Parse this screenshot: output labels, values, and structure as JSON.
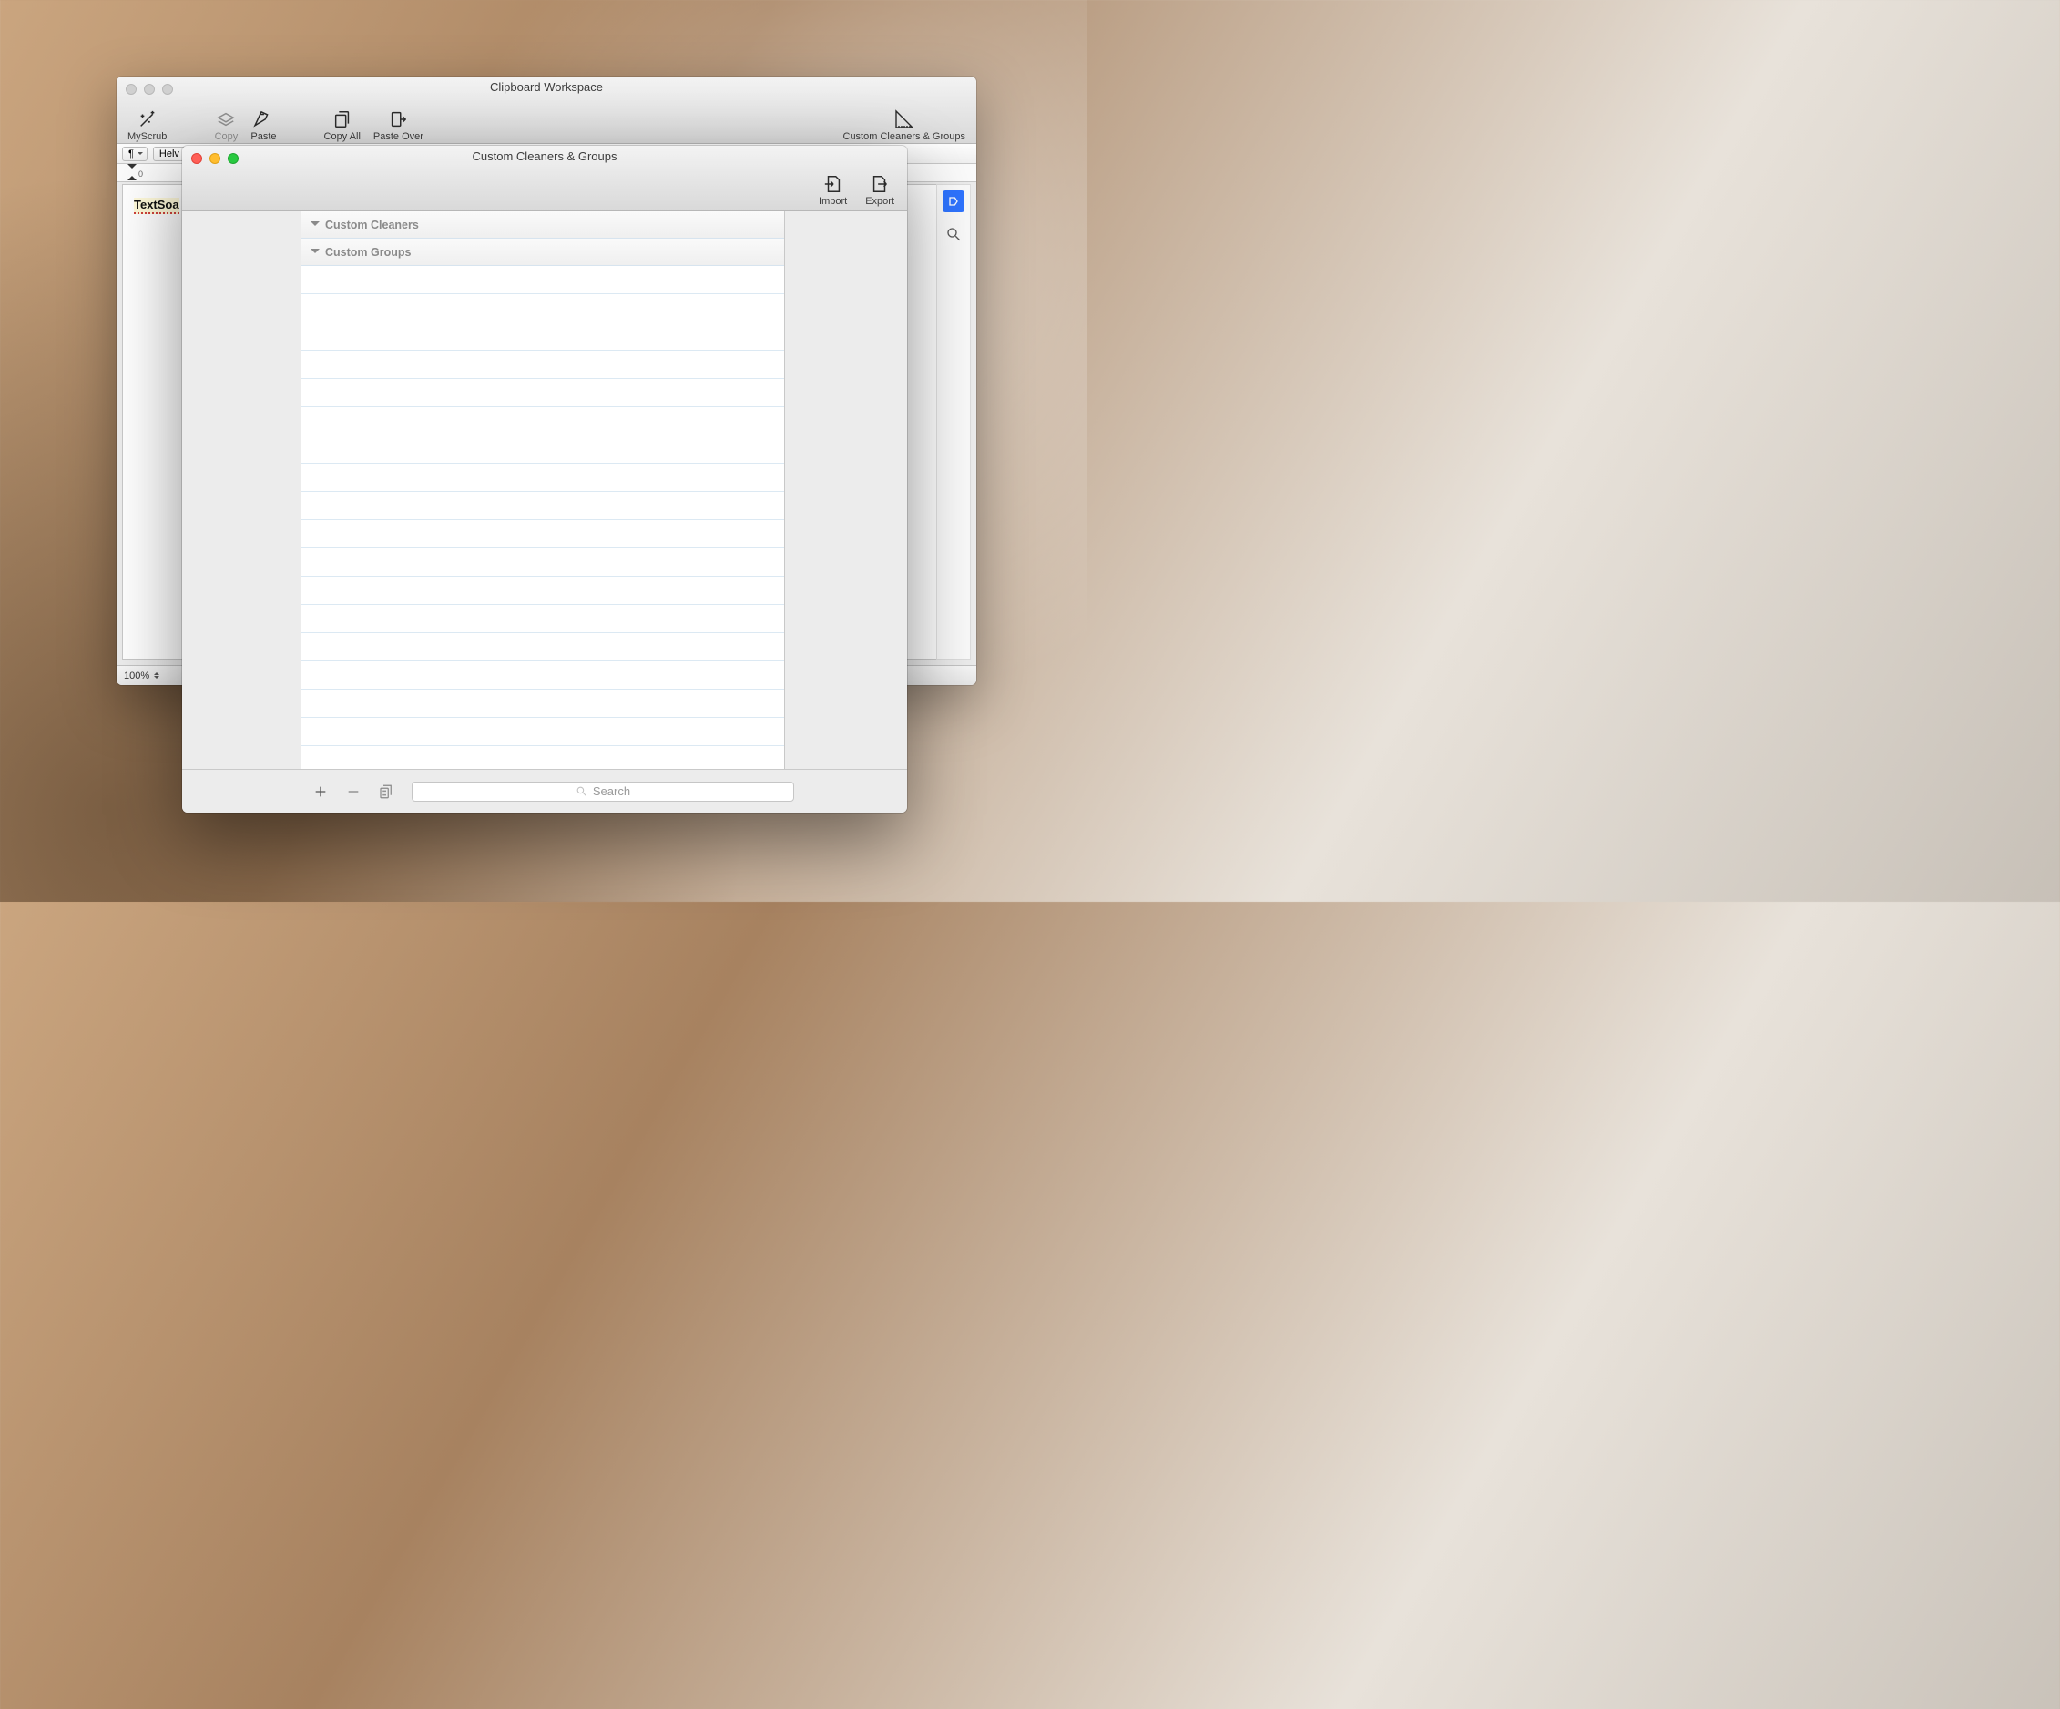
{
  "back": {
    "title": "Clipboard Workspace",
    "toolbar": {
      "myscrub": "MyScrub",
      "copy": "Copy",
      "paste": "Paste",
      "copy_all": "Copy All",
      "paste_over": "Paste Over",
      "custom": "Custom Cleaners & Groups"
    },
    "format": {
      "para": "¶",
      "font": "Helv"
    },
    "ruler_zero": "0",
    "doc_text": "TextSoa",
    "zoom": "100%"
  },
  "front": {
    "title": "Custom Cleaners & Groups",
    "toolbar": {
      "import": "Import",
      "export": "Export"
    },
    "sections": {
      "cleaners": "Custom Cleaners",
      "groups": "Custom Groups"
    },
    "search_placeholder": "Search"
  }
}
